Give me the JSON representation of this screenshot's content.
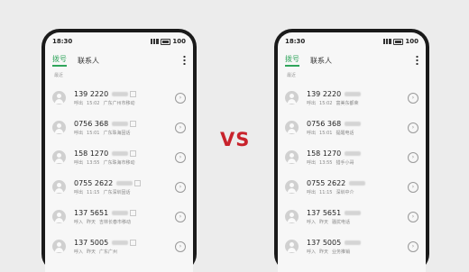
{
  "vs_label": "VS",
  "accent_color": "#2fa55b",
  "phones": [
    {
      "status": {
        "time": "18:30",
        "battery": "100"
      },
      "tabs": [
        "拨号",
        "联系人"
      ],
      "section": "最近",
      "calls": [
        {
          "number": "139 2220",
          "type": "呼出",
          "time": "15:02",
          "location": "广东广州市移动"
        },
        {
          "number": "0756 368",
          "type": "呼出",
          "time": "15:01",
          "location": "广东珠海固话"
        },
        {
          "number": "158 1270",
          "type": "呼出",
          "time": "13:55",
          "location": "广东珠海市移动"
        },
        {
          "number": "0755 2622",
          "type": "呼出",
          "time": "11:15",
          "location": "广东深圳固话"
        },
        {
          "number": "137 5651",
          "type": "呼入",
          "time": "昨天",
          "location": "吉林长春市移动"
        },
        {
          "number": "137 5005",
          "type": "呼入",
          "time": "昨天",
          "location": "广东广州"
        }
      ]
    },
    {
      "status": {
        "time": "18:30",
        "battery": "100"
      },
      "tabs": [
        "拨号",
        "联系人"
      ],
      "section": "最近",
      "calls": [
        {
          "number": "139 2220",
          "type": "呼出",
          "time": "15:02",
          "location": "富美东都荣"
        },
        {
          "number": "0756 368",
          "type": "呼出",
          "time": "15:01",
          "location": "提醒电话"
        },
        {
          "number": "158 1270",
          "type": "呼出",
          "time": "13:55",
          "location": "猎手小哥"
        },
        {
          "number": "0755 2622",
          "type": "呼出",
          "time": "11:15",
          "location": "深圳中介"
        },
        {
          "number": "137 5651",
          "type": "呼入",
          "time": "昨天",
          "location": "骚扰电话"
        },
        {
          "number": "137 5005",
          "type": "呼入",
          "time": "昨天",
          "location": "业务推销"
        }
      ]
    }
  ]
}
